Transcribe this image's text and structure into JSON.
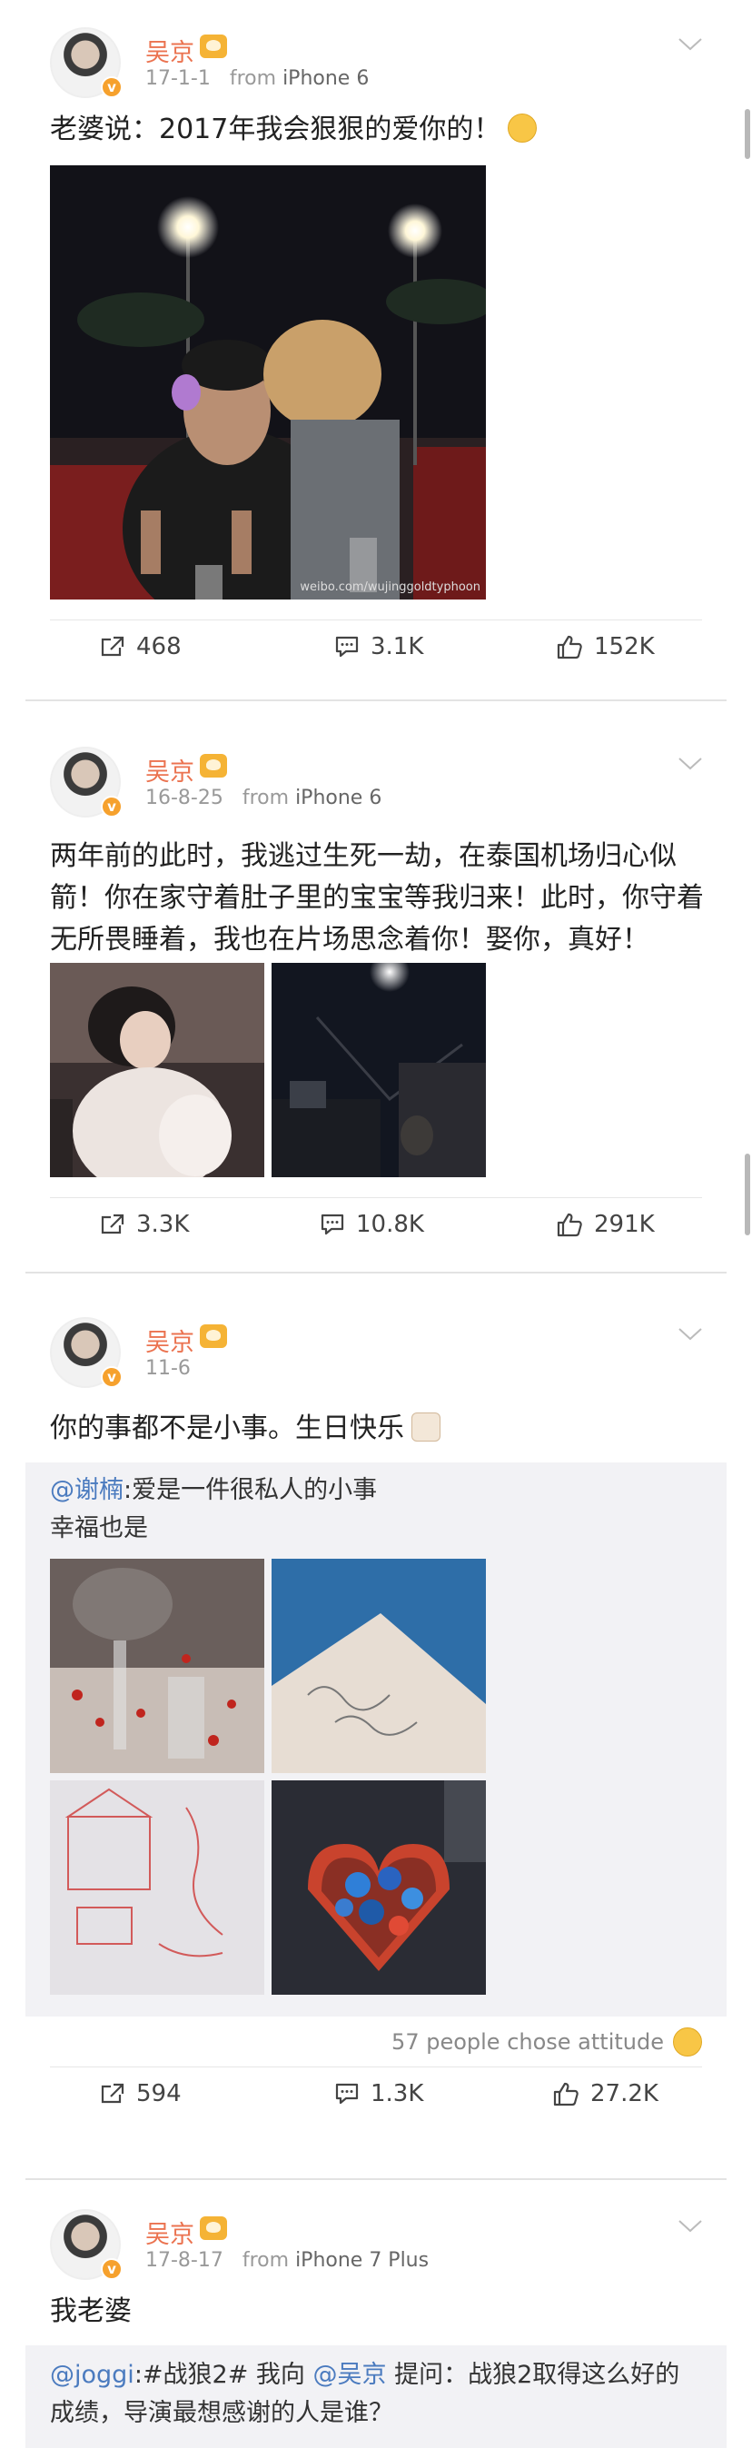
{
  "posts": [
    {
      "username": "吴京",
      "date": "17-1-1",
      "from_label": "from",
      "source": "iPhone 6",
      "text": "老婆说：2017年我会狠狠的爱你的！",
      "emoji": "surprised-face",
      "watermark": "weibo.com/wujinggoldtyphoon",
      "reposts": "468",
      "comments": "3.1K",
      "likes": "152K"
    },
    {
      "username": "吴京",
      "date": "16-8-25",
      "from_label": "from",
      "source": "iPhone 6",
      "text": "两年前的此时，我逃过生死一劫，在泰国机场归心似箭！你在家守着肚子里的宝宝等我归来！此时，你守着无所畏睡着，我也在片场思念着你！娶你，真好！",
      "reposts": "3.3K",
      "comments": "10.8K",
      "likes": "291K"
    },
    {
      "username": "吴京",
      "date": "11-6",
      "text": "你的事都不是小事。生日快乐",
      "emoji": "cake",
      "repost_mention": "@谢楠",
      "repost_text": ":爱是一件很私人的小事",
      "repost_text2": "幸福也是",
      "attitude": "57 people chose attitude",
      "reposts": "594",
      "comments": "1.3K",
      "likes": "27.2K"
    },
    {
      "username": "吴京",
      "date": "17-8-17",
      "from_label": "from",
      "source": "iPhone 7 Plus",
      "text": "我老婆",
      "repost_mention": "@joggi",
      "repost_part1": ":#战狼2# 我向 ",
      "repost_mention2": "@吴京",
      "repost_part2": " 提问：战狼2取得这么好的",
      "repost_line2": "成绩，导演最想感谢的人是谁？"
    }
  ],
  "colors": {
    "username": "#eb7350",
    "mention": "#4b7bbf",
    "repost_bg": "#f2f2f5"
  }
}
